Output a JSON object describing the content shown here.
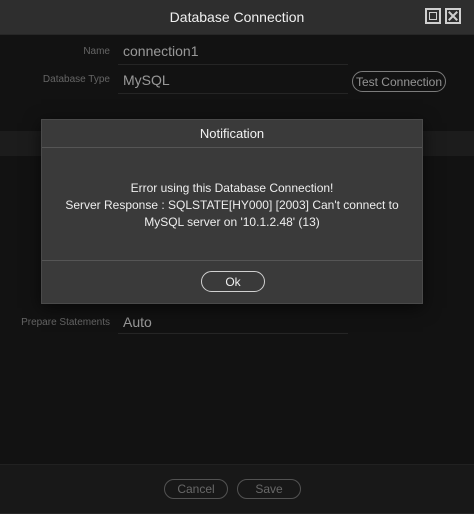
{
  "window": {
    "title": "Database Connection"
  },
  "form": {
    "name_label": "Name",
    "name_value": "connection1",
    "db_type_label": "Database Type",
    "db_type_value": "MySQL",
    "test_button": "Test Connection",
    "prepare_label": "Prepare Statements",
    "prepare_value": "Auto"
  },
  "footer": {
    "cancel_label": "Cancel",
    "save_label": "Save"
  },
  "dialog": {
    "title": "Notification",
    "message_line1": "Error using this Database Connection!",
    "message_line2": "Server Response : SQLSTATE[HY000] [2003] Can't connect to",
    "message_line3": "MySQL server on '10.1.2.48' (13)",
    "ok_label": "Ok"
  }
}
